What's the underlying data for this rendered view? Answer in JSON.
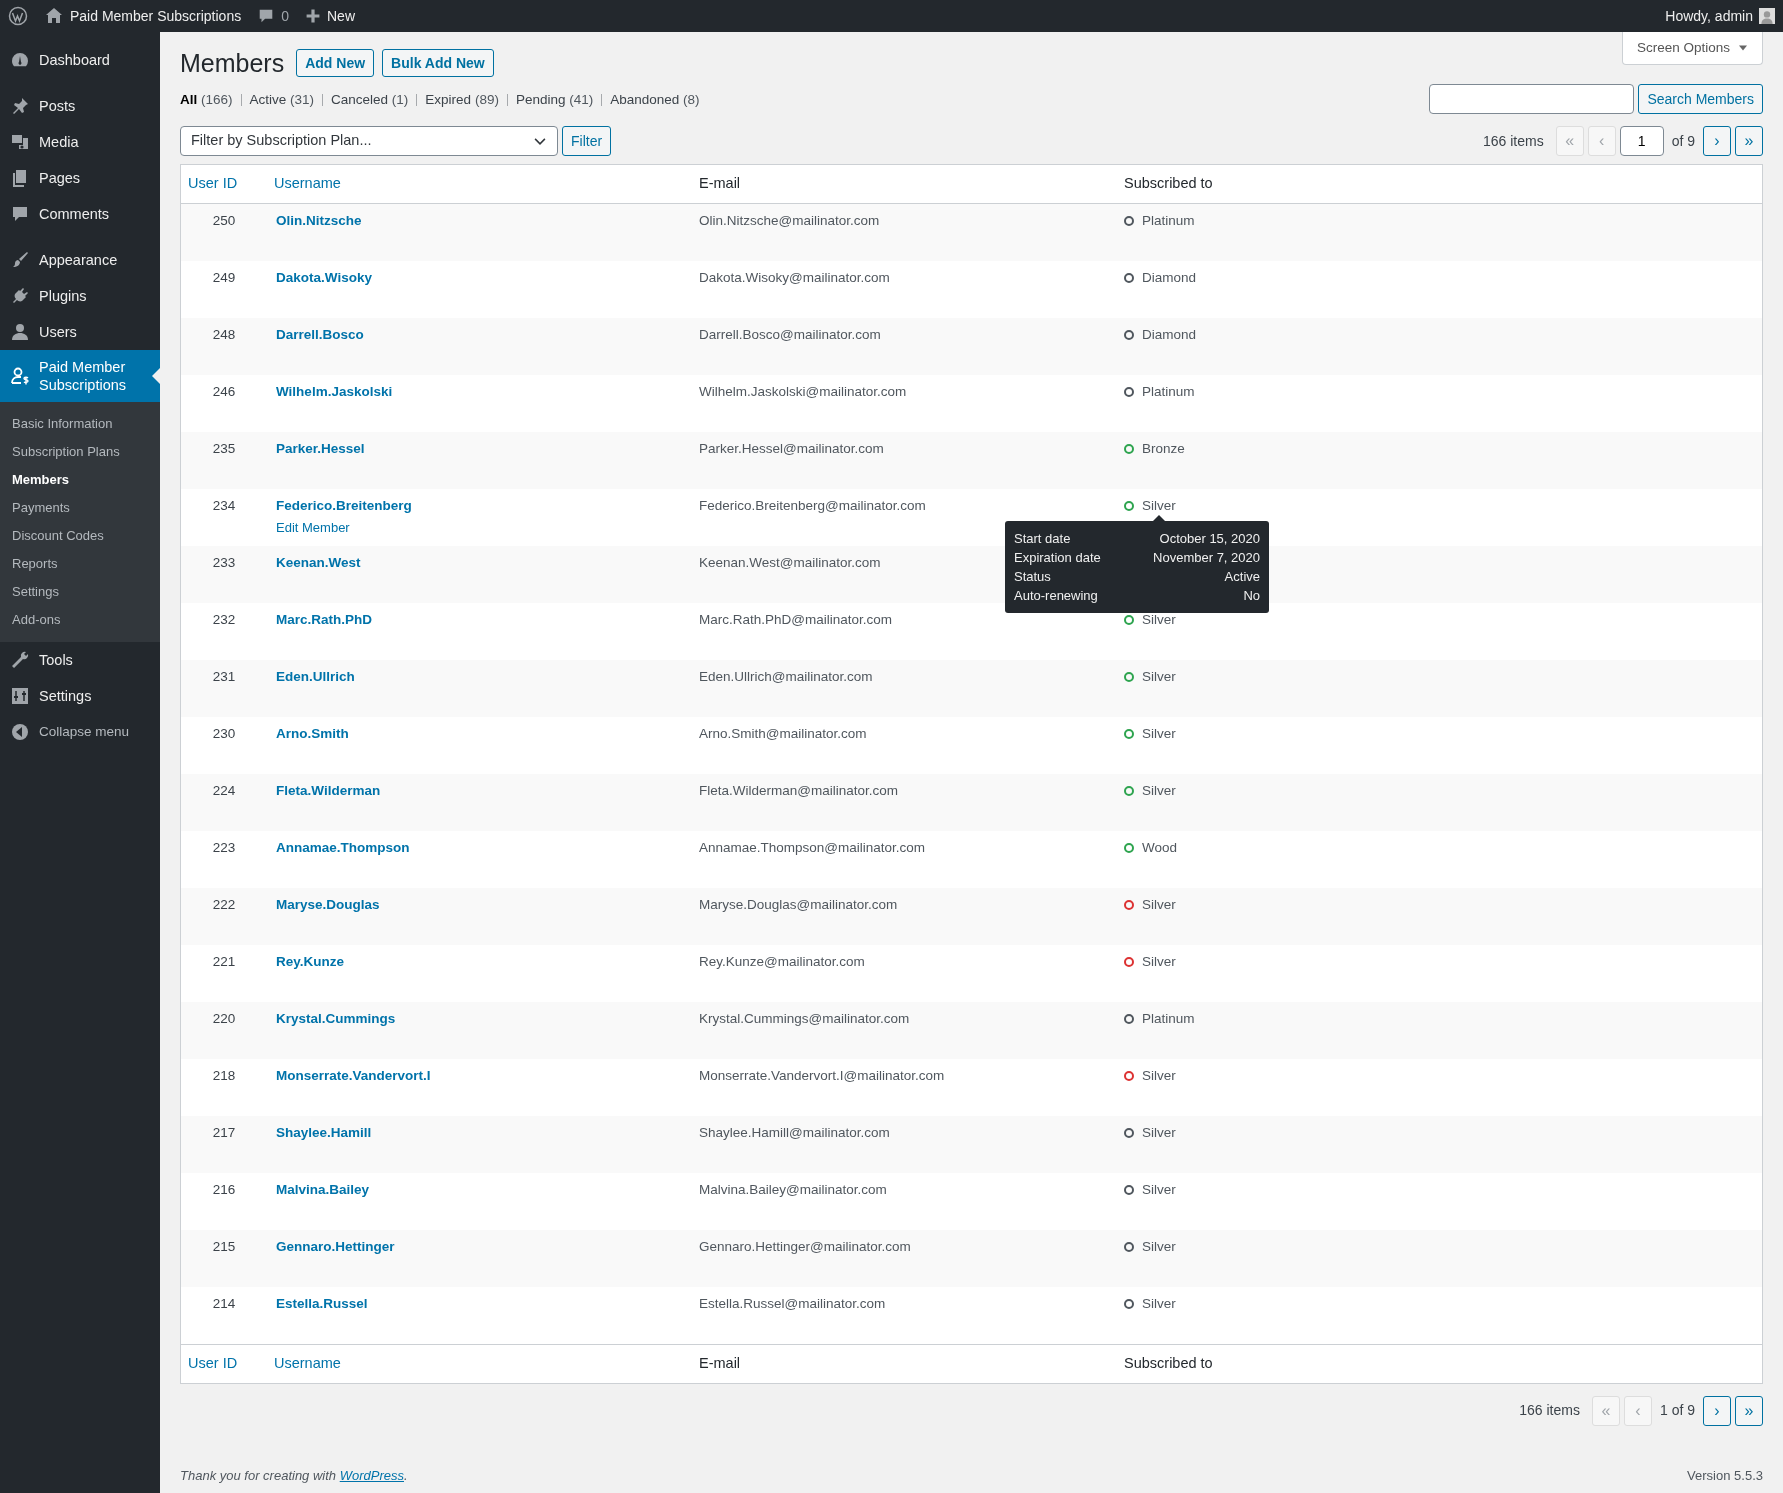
{
  "admin_bar": {
    "site_name": "Paid Member Subscriptions",
    "comments_count": "0",
    "new_label": "New",
    "greeting": "Howdy, admin"
  },
  "sidebar": {
    "groups": [
      [
        {
          "label": "Dashboard",
          "selected": false
        }
      ],
      [
        {
          "label": "Posts",
          "selected": false
        },
        {
          "label": "Media",
          "selected": false
        },
        {
          "label": "Pages",
          "selected": false
        },
        {
          "label": "Comments",
          "selected": false
        }
      ],
      [
        {
          "label": "Appearance",
          "selected": false
        },
        {
          "label": "Plugins",
          "selected": false
        },
        {
          "label": "Users",
          "selected": false
        },
        {
          "label": "Paid Member Subscriptions",
          "selected": true,
          "children": [
            {
              "label": "Basic Information",
              "selected": false
            },
            {
              "label": "Subscription Plans",
              "selected": false
            },
            {
              "label": "Members",
              "selected": true
            },
            {
              "label": "Payments",
              "selected": false
            },
            {
              "label": "Discount Codes",
              "selected": false
            },
            {
              "label": "Reports",
              "selected": false
            },
            {
              "label": "Settings",
              "selected": false
            },
            {
              "label": "Add-ons",
              "selected": false
            }
          ]
        },
        {
          "label": "Tools",
          "selected": false
        },
        {
          "label": "Settings",
          "selected": false
        }
      ]
    ],
    "collapse_label": "Collapse menu"
  },
  "screen_options": "Screen Options",
  "page_title": "Members",
  "title_buttons": [
    "Add New",
    "Bulk Add New"
  ],
  "views": [
    {
      "label": "All",
      "count": "(166)",
      "selected": true
    },
    {
      "label": "Active",
      "count": "(31)",
      "selected": false
    },
    {
      "label": "Canceled",
      "count": "(1)",
      "selected": false
    },
    {
      "label": "Expired",
      "count": "(89)",
      "selected": false
    },
    {
      "label": "Pending",
      "count": "(41)",
      "selected": false
    },
    {
      "label": "Abandoned",
      "count": "(8)",
      "selected": false
    }
  ],
  "search_button": "Search Members",
  "filter": {
    "select": "Filter by Subscription Plan...",
    "button": "Filter"
  },
  "top_pagination": {
    "items": "166 items",
    "first": "«",
    "prev": "‹",
    "page": "1",
    "of": "of 9",
    "next": "›",
    "last": "»"
  },
  "table": {
    "columns": [
      {
        "label": "User ID",
        "sortable": true
      },
      {
        "label": "Username",
        "sortable": true
      },
      {
        "label": "E-mail",
        "sortable": false
      },
      {
        "label": "Subscribed to",
        "sortable": false
      }
    ],
    "rows": [
      {
        "id": "250",
        "username": "Olin.Nitzsche",
        "email": "Olin.Nitzsche@mailinator.com",
        "plan": "Platinum",
        "color": "#50575e"
      },
      {
        "id": "249",
        "username": "Dakota.Wisoky",
        "email": "Dakota.Wisoky@mailinator.com",
        "plan": "Diamond",
        "color": "#50575e"
      },
      {
        "id": "248",
        "username": "Darrell.Bosco",
        "email": "Darrell.Bosco@mailinator.com",
        "plan": "Diamond",
        "color": "#50575e"
      },
      {
        "id": "246",
        "username": "Wilhelm.Jaskolski",
        "email": "Wilhelm.Jaskolski@mailinator.com",
        "plan": "Platinum",
        "color": "#50575e"
      },
      {
        "id": "235",
        "username": "Parker.Hessel",
        "email": "Parker.Hessel@mailinator.com",
        "plan": "Bronze",
        "color": "#2ea44f"
      },
      {
        "id": "234",
        "username": "Federico.Breitenberg",
        "email": "Federico.Breitenberg@mailinator.com",
        "plan": "Silver",
        "color": "#2ea44f",
        "row_action": "Edit Member",
        "tooltip": [
          {
            "label": "Start date",
            "value": "October 15, 2020"
          },
          {
            "label": "Expiration date",
            "value": "November 7, 2020"
          },
          {
            "label": "Status",
            "value": "Active"
          },
          {
            "label": "Auto-renewing",
            "value": "No"
          }
        ]
      },
      {
        "id": "233",
        "username": "Keenan.West",
        "email": "Keenan.West@mailinator.com"
      },
      {
        "id": "232",
        "username": "Marc.Rath.PhD",
        "email": "Marc.Rath.PhD@mailinator.com",
        "plan": "Silver",
        "color": "#2ea44f"
      },
      {
        "id": "231",
        "username": "Eden.Ullrich",
        "email": "Eden.Ullrich@mailinator.com",
        "plan": "Silver",
        "color": "#2ea44f"
      },
      {
        "id": "230",
        "username": "Arno.Smith",
        "email": "Arno.Smith@mailinator.com",
        "plan": "Silver",
        "color": "#2ea44f"
      },
      {
        "id": "224",
        "username": "Fleta.Wilderman",
        "email": "Fleta.Wilderman@mailinator.com",
        "plan": "Silver",
        "color": "#2ea44f"
      },
      {
        "id": "223",
        "username": "Annamae.Thompson",
        "email": "Annamae.Thompson@mailinator.com",
        "plan": "Wood",
        "color": "#2ea44f"
      },
      {
        "id": "222",
        "username": "Maryse.Douglas",
        "email": "Maryse.Douglas@mailinator.com",
        "plan": "Silver",
        "color": "#dc3232"
      },
      {
        "id": "221",
        "username": "Rey.Kunze",
        "email": "Rey.Kunze@mailinator.com",
        "plan": "Silver",
        "color": "#dc3232"
      },
      {
        "id": "220",
        "username": "Krystal.Cummings",
        "email": "Krystal.Cummings@mailinator.com",
        "plan": "Platinum",
        "color": "#50575e"
      },
      {
        "id": "218",
        "username": "Monserrate.Vandervort.I",
        "email": "Monserrate.Vandervort.I@mailinator.com",
        "plan": "Silver",
        "color": "#dc3232"
      },
      {
        "id": "217",
        "username": "Shaylee.Hamill",
        "email": "Shaylee.Hamill@mailinator.com",
        "plan": "Silver",
        "color": "#50575e"
      },
      {
        "id": "216",
        "username": "Malvina.Bailey",
        "email": "Malvina.Bailey@mailinator.com",
        "plan": "Silver",
        "color": "#50575e"
      },
      {
        "id": "215",
        "username": "Gennaro.Hettinger",
        "email": "Gennaro.Hettinger@mailinator.com",
        "plan": "Silver",
        "color": "#50575e"
      },
      {
        "id": "214",
        "username": "Estella.Russel",
        "email": "Estella.Russel@mailinator.com",
        "plan": "Silver",
        "color": "#50575e"
      }
    ],
    "footer_columns": [
      {
        "label": "User ID",
        "sortable": true
      },
      {
        "label": "Username",
        "sortable": true
      },
      {
        "label": "E-mail",
        "sortable": false
      },
      {
        "label": "Subscribed to",
        "sortable": false
      }
    ]
  },
  "bottom_pagination": {
    "items": "166 items",
    "first": "«",
    "prev": "‹",
    "page_of": "1 of 9",
    "next": "›",
    "last": "»"
  },
  "footer": {
    "before": "Thank you for creating with ",
    "link": "WordPress",
    "after": ".",
    "version": "Version 5.5.3"
  }
}
